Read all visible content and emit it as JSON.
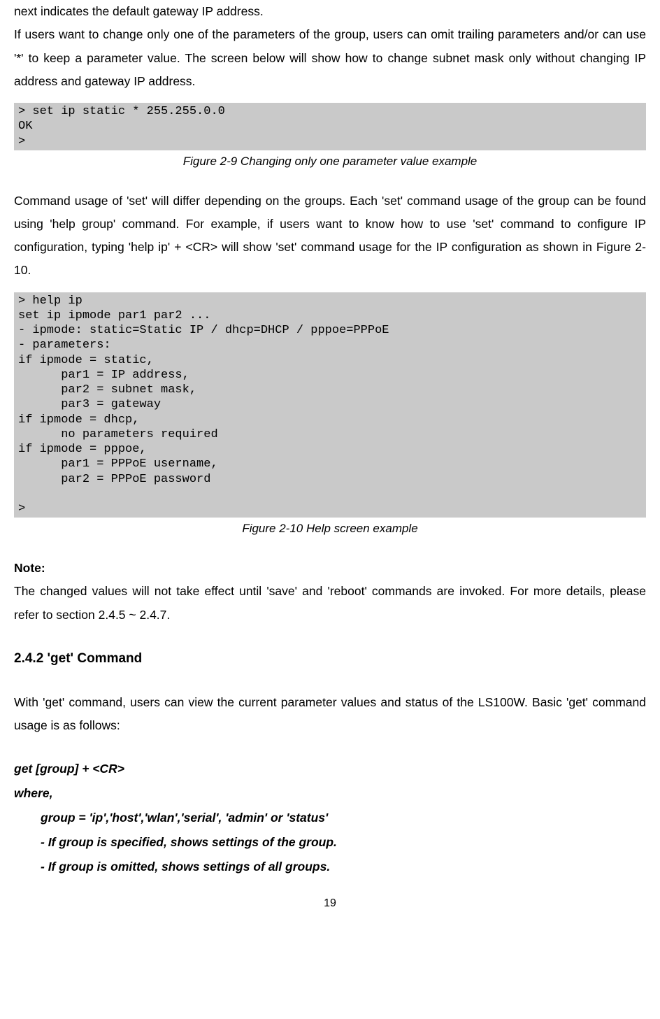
{
  "para_intro_1": "next indicates the default gateway IP address.",
  "para_intro_2": "If users want to change only one of the parameters of the group, users can omit trailing parameters and/or can use '*' to keep a parameter value. The screen below will show how to change subnet mask only without changing IP address and gateway IP address.",
  "code_block_1": "> set ip static * 255.255.0.0\nOK\n>",
  "figure_caption_1": "Figure 2-9 Changing only one parameter value example",
  "para_usage": "Command usage of 'set' will differ depending on the groups. Each 'set' command usage of the group can be found using 'help group' command. For example, if users want to know how to use 'set' command to configure IP configuration, typing 'help ip' + <CR> will show 'set' command usage for the IP configuration as shown in Figure 2-10.",
  "code_block_2": "> help ip\nset ip ipmode par1 par2 ...\n- ipmode: static=Static IP / dhcp=DHCP / pppoe=PPPoE\n- parameters:\nif ipmode = static,\n      par1 = IP address,\n      par2 = subnet mask,\n      par3 = gateway\nif ipmode = dhcp,\n      no parameters required\nif ipmode = pppoe,\n      par1 = PPPoE username,\n      par2 = PPPoE password\n\n>",
  "figure_caption_2": "Figure 2-10 Help screen example",
  "note_label": "Note:",
  "note_text": "The changed values will not take effect until 'save' and 'reboot' commands are invoked. For more details, please refer to section 2.4.5 ~ 2.4.7.",
  "section_heading": "2.4.2 'get' Command",
  "para_get": "With 'get' command, users can view the current parameter values and status of the LS100W. Basic 'get' command usage is as follows:",
  "syntax_line_1": "get [group] + <CR>",
  "syntax_line_2": "where,",
  "syntax_line_3": "group = 'ip','host','wlan','serial', 'admin' or 'status'",
  "syntax_line_4": "- If group is specified, shows settings of the group.",
  "syntax_line_5": "- If group is omitted, shows settings of all groups.",
  "page_number": "19"
}
